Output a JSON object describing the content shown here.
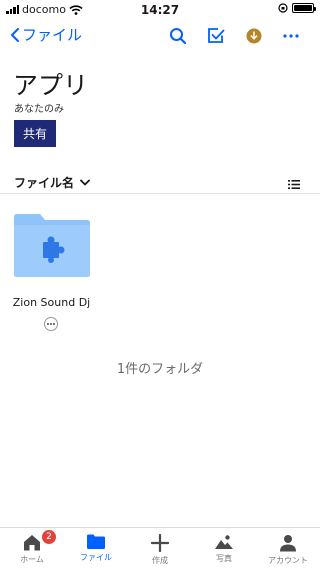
{
  "status_bar": {
    "carrier": "docomo",
    "time": "14:27"
  },
  "nav": {
    "back_label": "ファイル",
    "icons": [
      "search-icon",
      "select-checkbox-icon",
      "download-badge-icon",
      "more-icon"
    ]
  },
  "header": {
    "title": "アプリ",
    "subtitle": "あなたのみ",
    "share_label": "共有"
  },
  "sort": {
    "label": "ファイル名"
  },
  "folder": {
    "name": "Zion Sound Dj"
  },
  "folder_count": "1件のフォルダ",
  "tabs": [
    {
      "label": "ホーム",
      "badge": "2"
    },
    {
      "label": "ファイル"
    },
    {
      "label": "作成"
    },
    {
      "label": "写真"
    },
    {
      "label": "アカウント"
    }
  ],
  "colors": {
    "accent": "#0061fe",
    "share_button": "#1e2a78",
    "folder": "#8fc3fb",
    "badge": "#e0453a"
  }
}
